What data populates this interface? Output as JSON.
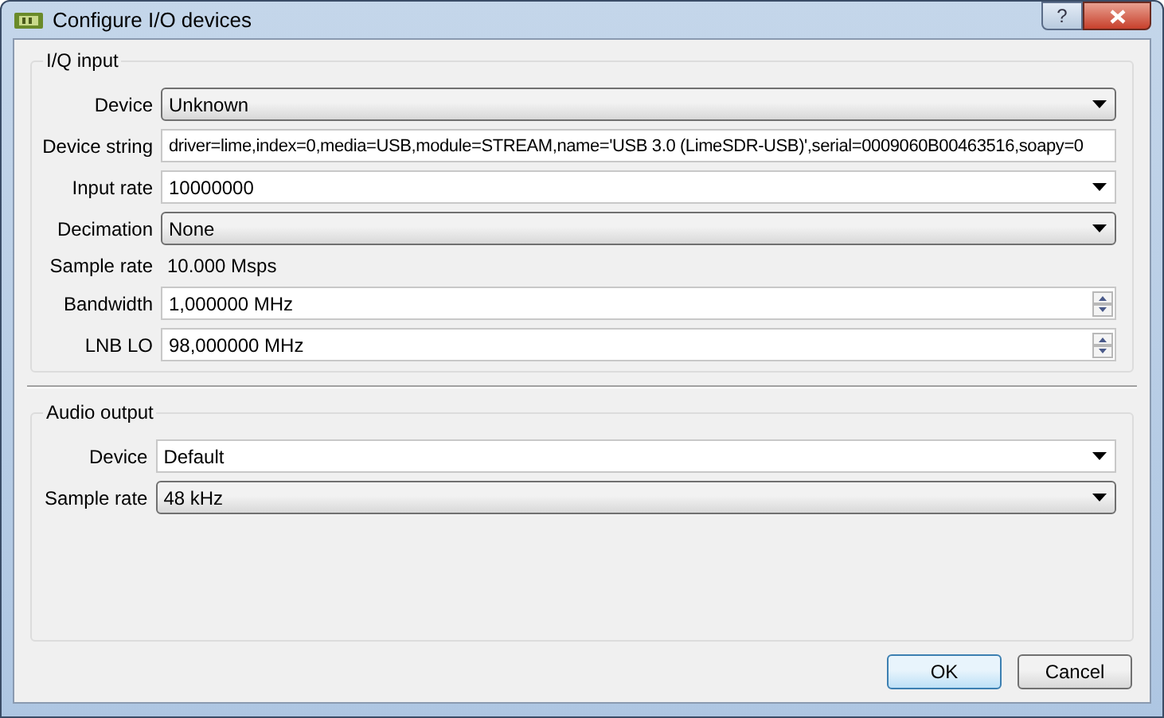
{
  "window": {
    "title": "Configure I/O devices",
    "help_button": "?"
  },
  "groups": [
    {
      "title": "I/Q input",
      "rows": [
        {
          "label": "Device",
          "kind": "dropdown",
          "value": "Unknown"
        },
        {
          "label": "Device string",
          "kind": "text",
          "value": "driver=lime,index=0,media=USB,module=STREAM,name='USB 3.0 (LimeSDR-USB)',serial=0009060B00463516,soapy=0"
        },
        {
          "label": "Input rate",
          "kind": "combo",
          "value": "10000000"
        },
        {
          "label": "Decimation",
          "kind": "dropdown",
          "value": "None"
        },
        {
          "label": "Sample rate",
          "kind": "readout",
          "value": "10.000 Msps"
        },
        {
          "label": "Bandwidth",
          "kind": "spin",
          "value": "1,000000 MHz"
        },
        {
          "label": "LNB LO",
          "kind": "spin",
          "value": "98,000000 MHz"
        }
      ]
    },
    {
      "title": "Audio output",
      "rows": [
        {
          "label": "Device",
          "kind": "combo",
          "value": "Default"
        },
        {
          "label": "Sample rate",
          "kind": "dropdown",
          "value": "48 kHz"
        }
      ]
    }
  ],
  "buttons": [
    {
      "label": "OK",
      "default": true
    },
    {
      "label": "Cancel",
      "default": false
    }
  ]
}
